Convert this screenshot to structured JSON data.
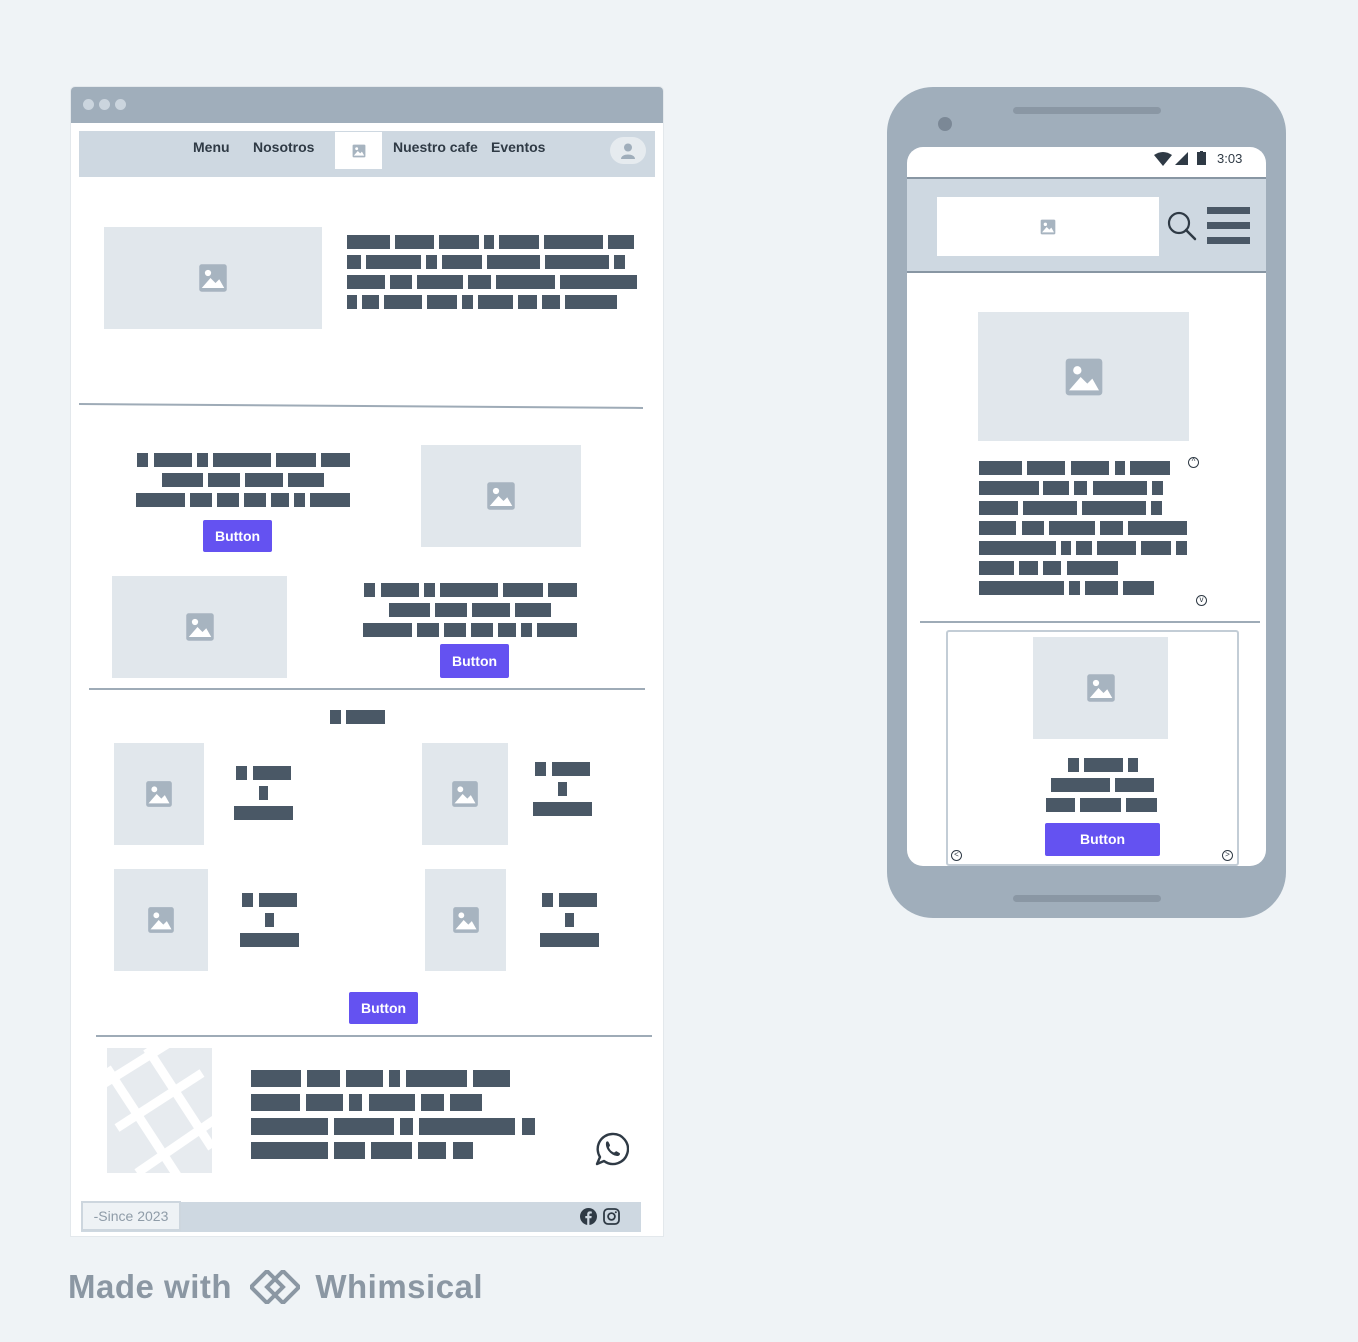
{
  "desktop": {
    "nav": {
      "items": [
        "Menu",
        "Nosotros",
        "Nuestro cafe",
        "Eventos"
      ]
    },
    "promo_buttons": [
      "Button",
      "Button"
    ],
    "gallery_button": "Button",
    "footer": {
      "since": "-Since 2023"
    }
  },
  "mobile": {
    "status": {
      "time": "3:03"
    },
    "card_button": "Button"
  },
  "branding": {
    "made_with": "Made with",
    "product": "Whimsical"
  },
  "colors": {
    "accent": "#6452f1",
    "placeholder": "#e1e7ec",
    "frame": "#a0aebb",
    "text_block": "#4a5866"
  }
}
